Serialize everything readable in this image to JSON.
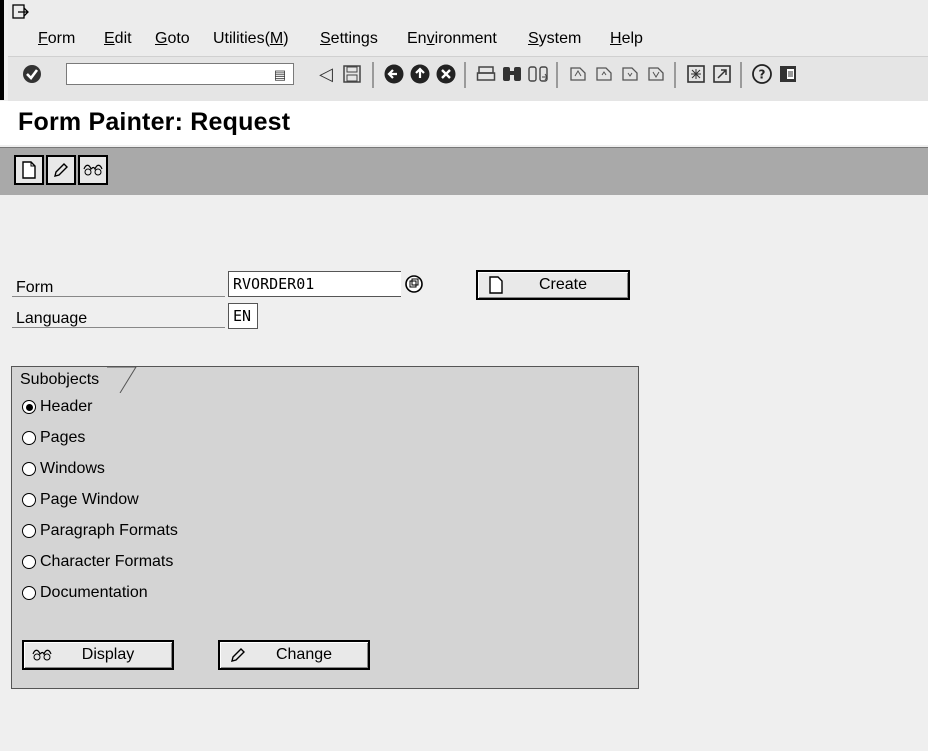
{
  "menu": {
    "items": [
      "Form",
      "Edit",
      "Goto",
      "Utilities(M)",
      "Settings",
      "Environment",
      "System",
      "Help"
    ]
  },
  "toolbar": {
    "command_value": ""
  },
  "screen": {
    "title": "Form Painter: Request"
  },
  "fields": {
    "form_label": "Form",
    "form_value": "RVORDER01",
    "language_label": "Language",
    "language_value": "EN"
  },
  "buttons": {
    "create": "Create",
    "display": "Display",
    "change": "Change"
  },
  "subobjects": {
    "title": "Subobjects",
    "options": [
      {
        "label": "Header",
        "selected": true
      },
      {
        "label": "Pages",
        "selected": false
      },
      {
        "label": "Windows",
        "selected": false
      },
      {
        "label": "Page Window",
        "selected": false
      },
      {
        "label": "Paragraph Formats",
        "selected": false
      },
      {
        "label": "Character Formats",
        "selected": false
      },
      {
        "label": "Documentation",
        "selected": false
      }
    ]
  }
}
